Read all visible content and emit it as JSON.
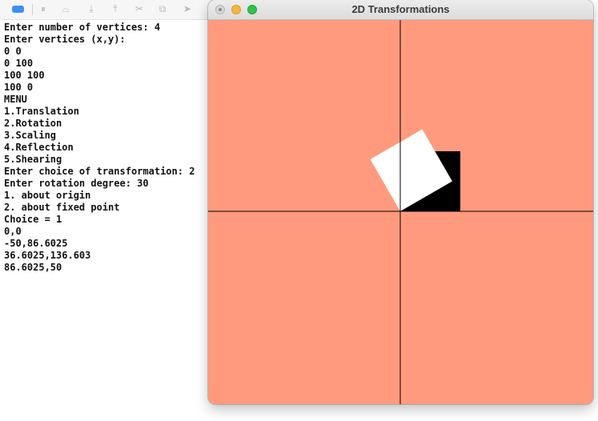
{
  "window": {
    "title": "2D Transformations"
  },
  "console_lines": [
    "Enter number of vertices: 4",
    "Enter vertices (x,y):",
    "0 0",
    "0 100",
    "100 100",
    "100 0",
    "MENU",
    "1.Translation",
    "2.Rotation",
    "3.Scaling",
    "4.Reflection",
    "5.Shearing",
    "Enter choice of transformation: 2",
    "Enter rotation degree: 30",
    "1. about origin",
    "2. about fixed point",
    "Choice = 1",
    "0,0",
    "-50,86.6025",
    "36.6025,136.603",
    "86.6025,50"
  ],
  "colors": {
    "canvas_bg": "#ff9a7e",
    "original_shape": "#000000",
    "transformed_shape": "#ffffff",
    "axes": "#000000"
  },
  "scene": {
    "original_polygon": [
      [
        0,
        0
      ],
      [
        0,
        100
      ],
      [
        100,
        100
      ],
      [
        100,
        0
      ]
    ],
    "transformed_polygon": [
      [
        0,
        0
      ],
      [
        -50,
        86.6025
      ],
      [
        36.6025,
        136.603
      ],
      [
        86.6025,
        50
      ]
    ]
  },
  "icons": [
    "breakpoint-icon",
    "pause-icon",
    "step-over-icon",
    "step-into-icon",
    "step-out-icon",
    "debug-graph-icon",
    "environment-icon",
    "location-icon"
  ]
}
